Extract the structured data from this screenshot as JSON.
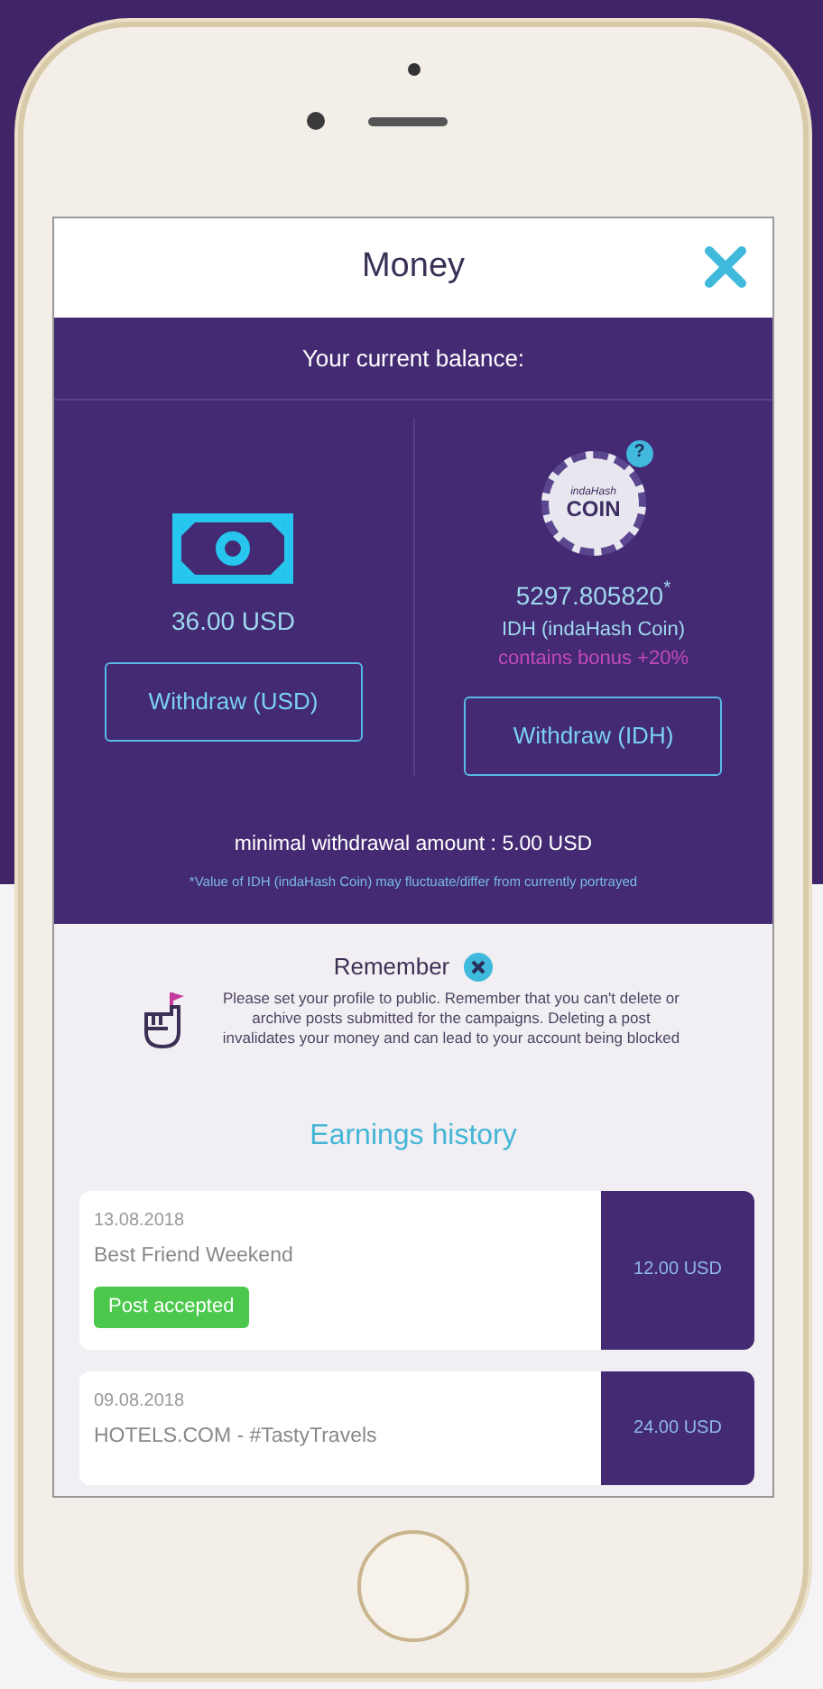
{
  "header": {
    "title": "Money"
  },
  "balance": {
    "heading": "Your current balance:",
    "usd": {
      "amount": "36.00 USD",
      "button": "Withdraw (USD)"
    },
    "idh": {
      "logo_small": "indaHash",
      "logo_main": "COIN",
      "help": "?",
      "amount": "5297.805820$^{*}$",
      "unit": "IDH (indaHash Coin)",
      "bonus": "contains bonus +20%",
      "button": "Withdraw (IDH)"
    },
    "minimum": "minimal withdrawal amount : 5.00 USD",
    "note": "*Value of IDH (indaHash Coin) may fluctuate/differ from currently portrayed"
  },
  "reminder": {
    "title": "Remember",
    "text": "Please set your profile to public. Remember that you can't delete or archive posts submitted for the campaigns. Deleting a post invalidates your money and can lead to your account being blocked"
  },
  "earnings": {
    "title": "Earnings history",
    "items": [
      {
        "date": "13.08.2018",
        "name": "Best Friend Weekend",
        "status": "Post accepted",
        "amount": "12.00 USD"
      },
      {
        "date": "09.08.2018",
        "name": "HOTELS.COM - #TastyTravels",
        "amount": "24.00 USD"
      }
    ]
  }
}
